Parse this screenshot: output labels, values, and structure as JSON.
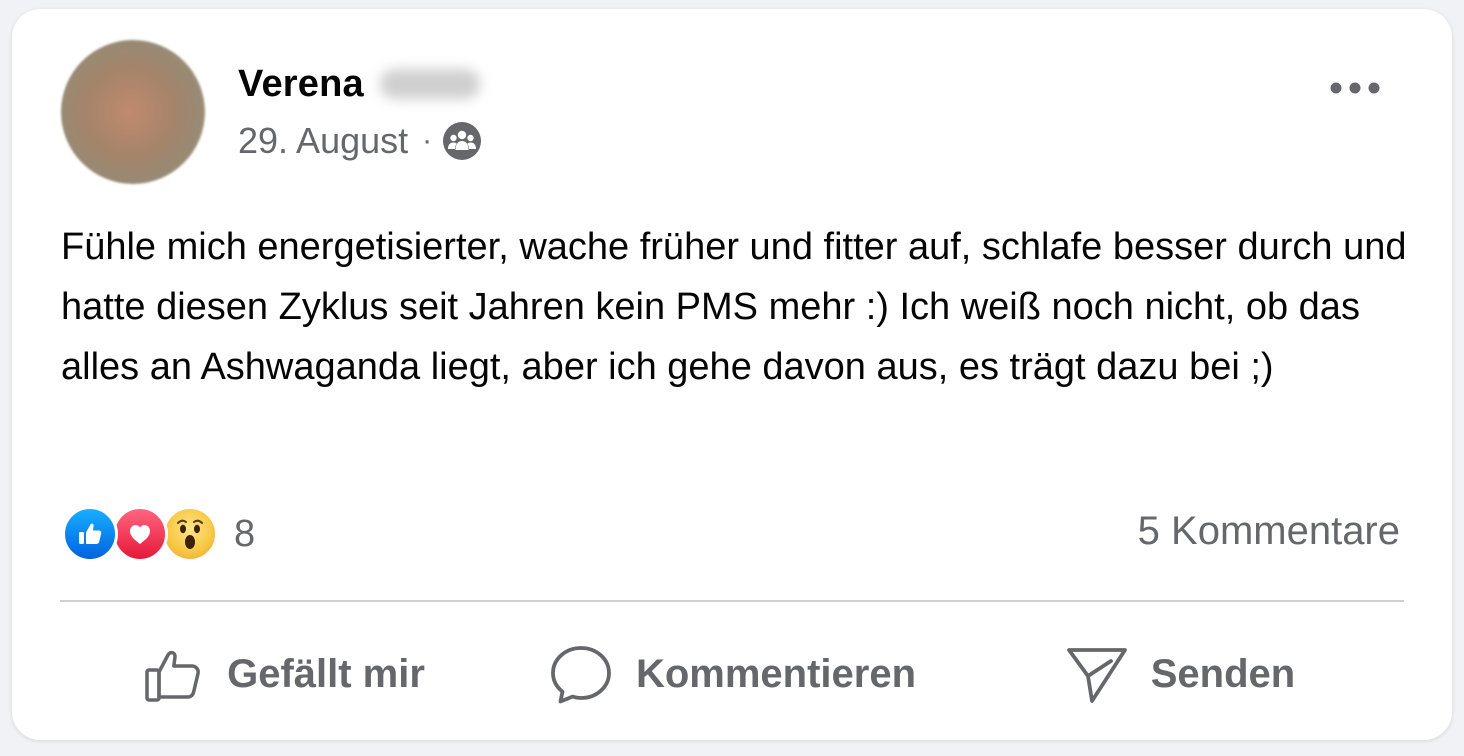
{
  "post": {
    "author": {
      "first_name": "Verena",
      "avatar_icon": "user-avatar"
    },
    "date": "29. August",
    "separator": "·",
    "audience_icon": "group-icon",
    "more_icon": "more-horizontal-icon",
    "text": "Fühle mich energetisierter, wache früher und fitter auf, schlafe besser durch und hatte diesen Zyklus seit Jahren kein PMS mehr :) Ich weiß noch nicht, ob das alles an Ashwaganda liegt, aber ich gehe davon aus, es trägt dazu bei ;)"
  },
  "reactions": {
    "icons": [
      "like-reaction-icon",
      "love-reaction-icon",
      "wow-reaction-icon"
    ],
    "count": "8"
  },
  "comments": {
    "label": "5 Kommentare"
  },
  "actions": {
    "like_label": "Gefällt mir",
    "comment_label": "Kommentieren",
    "share_label": "Senden"
  },
  "colors": {
    "like_blue": "#0866ff",
    "love_red": "#f33e58",
    "wow_yellow": "#f7c946",
    "secondary_text": "#65676b",
    "primary_text": "#050505"
  }
}
